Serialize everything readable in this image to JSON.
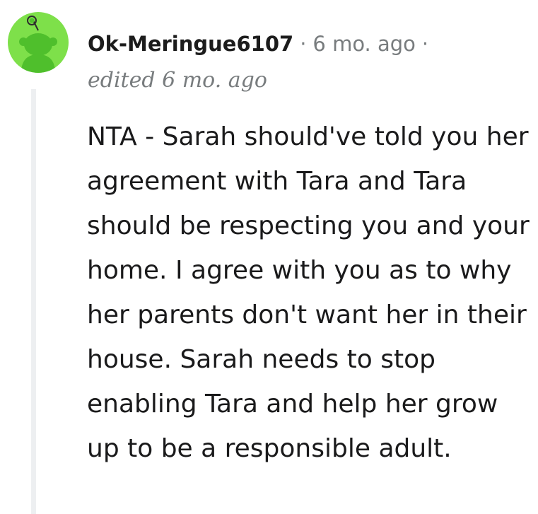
{
  "comment": {
    "username": "Ok-Meringue6107",
    "separator": "·",
    "timestamp": "6 mo. ago",
    "edited": "edited 6 mo. ago",
    "body": "NTA - Sarah should've told you her agreement with Tara and Tara should be respecting you and your home. I agree with you as to why her parents don't want her in their house. Sarah needs to stop enabling Tara and help her grow up to be a responsible adult."
  },
  "colors": {
    "avatar_background": "#7ee04a",
    "avatar_figure": "#4fbf2c",
    "meta_text": "#787c7e",
    "thread_line": "#edeff1"
  },
  "icons": {
    "avatar": "snoo-avatar-icon"
  }
}
